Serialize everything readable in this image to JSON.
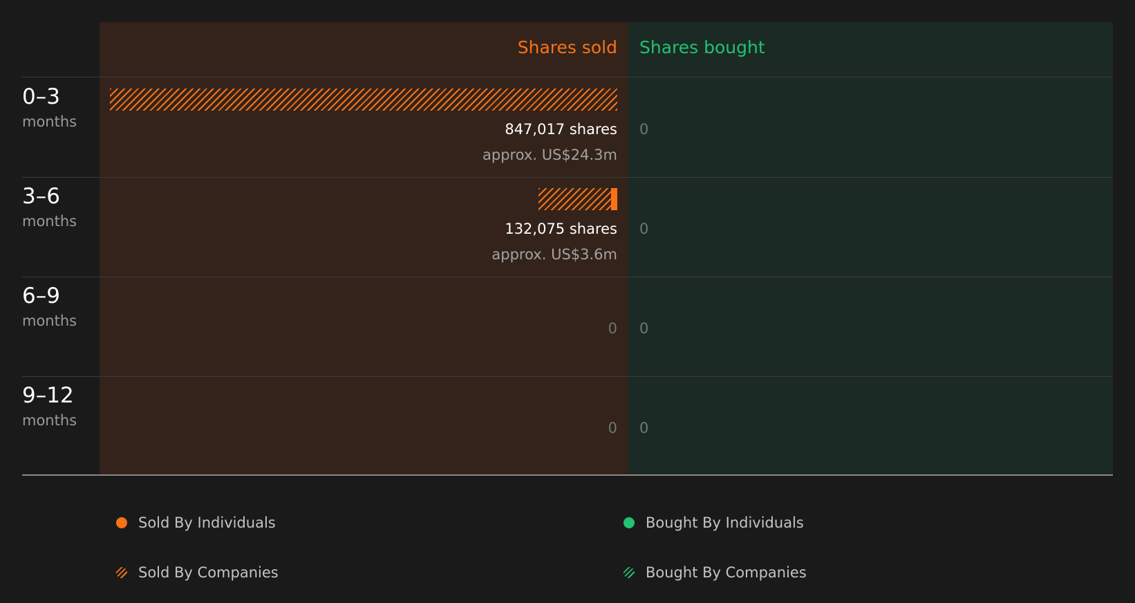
{
  "colors": {
    "sold": "#f97316",
    "bought": "#22c272",
    "sold_bg": "#33231b",
    "bought_bg": "#1b2a24"
  },
  "chart_data": {
    "type": "bar",
    "orientation": "horizontal-diverging",
    "columns": {
      "sold_label": "Shares sold",
      "bought_label": "Shares bought"
    },
    "categories": [
      {
        "period": "0–3",
        "unit": "months"
      },
      {
        "period": "3–6",
        "unit": "months"
      },
      {
        "period": "6–9",
        "unit": "months"
      },
      {
        "period": "9–12",
        "unit": "months"
      }
    ],
    "sold": [
      {
        "total": 847017,
        "companies": 847017,
        "individuals": 0,
        "shares_label": "847,017 shares",
        "usd_label": "approx. US$24.3m"
      },
      {
        "total": 132075,
        "companies": 122075,
        "individuals": 10000,
        "shares_label": "132,075 shares",
        "usd_label": "approx. US$3.6m"
      },
      {
        "total": 0,
        "companies": 0,
        "individuals": 0,
        "zero_label": "0"
      },
      {
        "total": 0,
        "companies": 0,
        "individuals": 0,
        "zero_label": "0"
      }
    ],
    "bought": [
      {
        "total": 0,
        "zero_label": "0"
      },
      {
        "total": 0,
        "zero_label": "0"
      },
      {
        "total": 0,
        "zero_label": "0"
      },
      {
        "total": 0,
        "zero_label": "0"
      }
    ],
    "legend": [
      {
        "label": "Sold By Individuals",
        "style": "solid",
        "color": "#f97316"
      },
      {
        "label": "Bought By Individuals",
        "style": "solid",
        "color": "#22c272"
      },
      {
        "label": "Sold By Companies",
        "style": "hatched",
        "color": "#f97316"
      },
      {
        "label": "Bought By Companies",
        "style": "hatched",
        "color": "#22c272"
      }
    ]
  }
}
